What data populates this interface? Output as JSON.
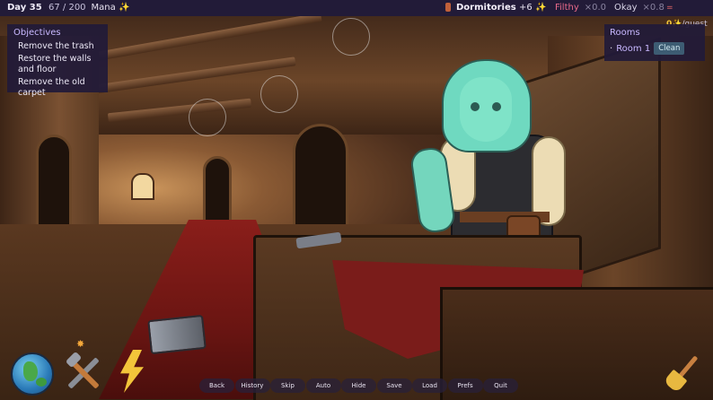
{
  "topbar": {
    "day": "Day 35",
    "mana_value": "67 / 200",
    "mana_label": "Mana",
    "room": "Dormitories",
    "room_bonus": "+6",
    "filthy_label": "Filthy",
    "filthy_mult": "×0.0",
    "okay_label": "Okay",
    "okay_mult": "×0.8",
    "guest_eq": "=",
    "guest_value": "0",
    "guest_label": "/guest"
  },
  "objectives": {
    "title": "Objectives",
    "items": [
      "Remove the trash",
      "Restore the walls and floor",
      "Remove the old carpet"
    ]
  },
  "rooms": {
    "title": "Rooms",
    "items": [
      {
        "name": "Room 1",
        "status": "Clean"
      }
    ]
  },
  "quick_menu": [
    "Back",
    "History",
    "Skip",
    "Auto",
    "Hide",
    "Save",
    "Load",
    "Prefs",
    "Quit"
  ],
  "icons": {
    "globe": "globe-icon",
    "tools": "hammer-wrench-icon",
    "energy": "lightning-bolt-icon",
    "broom": "broom-icon",
    "sparkle": "✨"
  },
  "colors": {
    "panel_bg": "#221b38",
    "accent_purple": "#c9b8ff",
    "filthy": "#e86a8a",
    "clean_badge": "#3d5c73",
    "mana_gold": "#f3c53a"
  }
}
